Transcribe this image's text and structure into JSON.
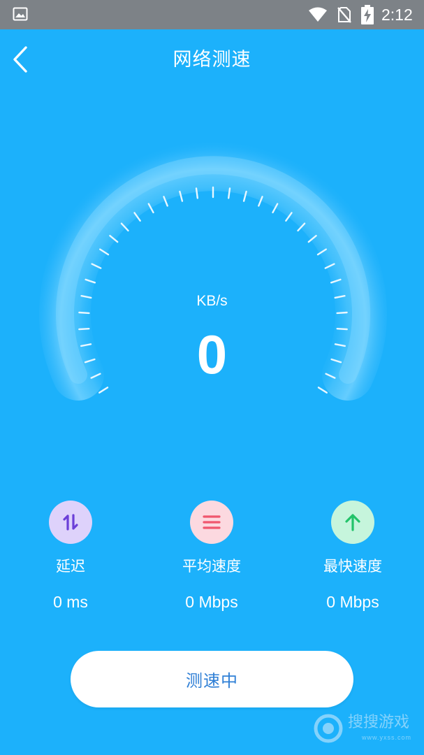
{
  "status_bar": {
    "time": "2:12",
    "icons": [
      "gallery-icon",
      "wifi-icon",
      "no-sim-icon",
      "battery-charging-icon"
    ]
  },
  "header": {
    "title": "网络测速",
    "back_icon": "chevron-left-icon"
  },
  "gauge": {
    "unit": "KB/s",
    "value": "0"
  },
  "stats": [
    {
      "label": "延迟",
      "value": "0 ms",
      "icon": "up-down-arrows-icon",
      "icon_bg": "#ded2fb",
      "icon_color": "#6b3fd8"
    },
    {
      "label": "平均速度",
      "value": "0 Mbps",
      "icon": "menu-lines-icon",
      "icon_bg": "#fcd9e0",
      "icon_color": "#f0566e"
    },
    {
      "label": "最快速度",
      "value": "0 Mbps",
      "icon": "arrow-up-icon",
      "icon_bg": "#c6f5dc",
      "icon_color": "#22c36a"
    }
  ],
  "action_button": {
    "label": "测速中"
  },
  "watermark": {
    "text": "搜搜游戏",
    "sub": "www.yxss.com"
  },
  "colors": {
    "background": "#1cb1fb",
    "status_bar": "#7d8287",
    "button_text": "#2f7fd6"
  }
}
